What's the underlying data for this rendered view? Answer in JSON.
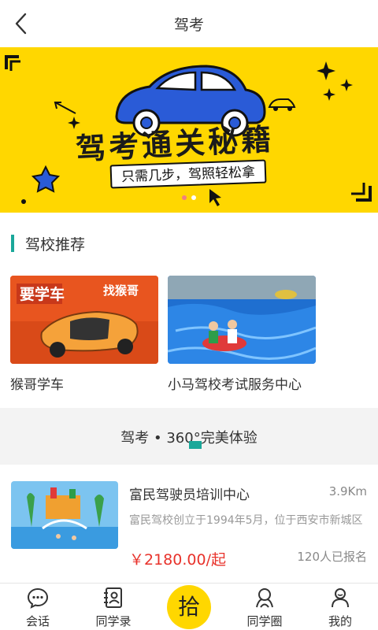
{
  "header": {
    "title": "驾考"
  },
  "banner": {
    "title": "驾考通关秘籍",
    "subtitle": "只需几步，驾照轻松拿",
    "slide_count": 2,
    "active_slide": 1,
    "bg_color": "#ffd700",
    "car_color": "#2a5bd7"
  },
  "section": {
    "title": "驾校推荐",
    "accent": "#1aa89a"
  },
  "schools": [
    {
      "name": "猴哥学车",
      "img_text_left": "要学车",
      "img_text_right": "找猴哥"
    },
    {
      "name": "小马驾校考试服务中心"
    }
  ],
  "band": {
    "title": "驾考 • 360°完美体验"
  },
  "listing": {
    "name": "富民驾驶员培训中心",
    "distance": "3.9Km",
    "description": "富民驾校创立于1994年5月，位于西安市新城区",
    "price": "￥2180.00/起",
    "signups": "120人已报名",
    "price_color": "#e8322b"
  },
  "tabbar": {
    "items": [
      {
        "label": "会话",
        "icon": "chat-bubble-icon"
      },
      {
        "label": "同学录",
        "icon": "address-book-icon"
      },
      {
        "label": "拾",
        "icon": "center-action"
      },
      {
        "label": "同学圈",
        "icon": "moments-icon"
      },
      {
        "label": "我的",
        "icon": "profile-icon"
      }
    ]
  }
}
